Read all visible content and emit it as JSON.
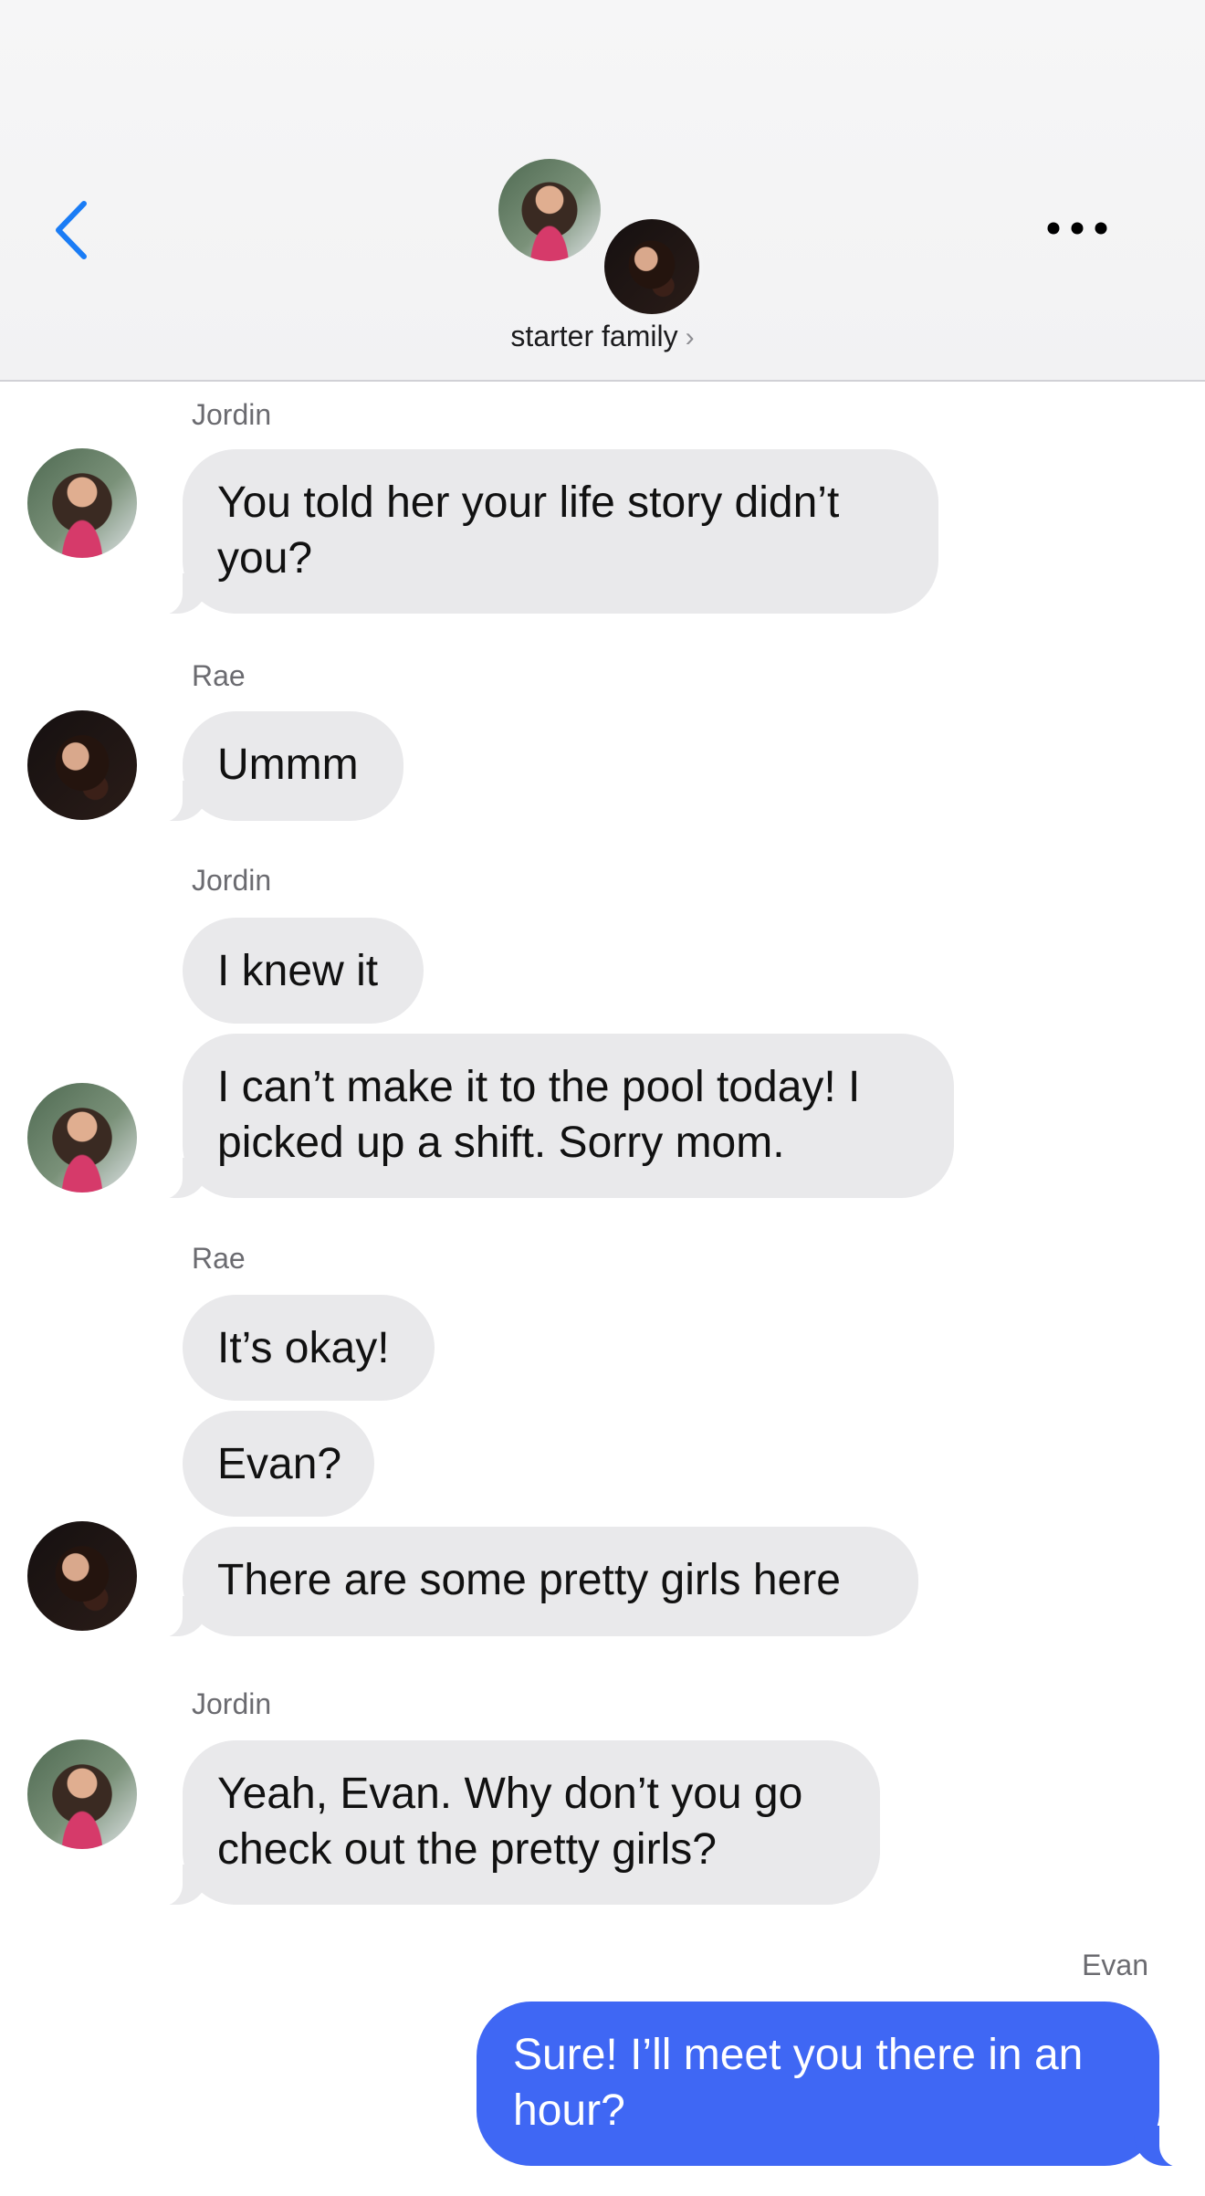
{
  "header": {
    "group_name": "starter family",
    "chevron": "›",
    "back_icon": "chevron-left-icon",
    "more_icon": "ellipsis-icon",
    "accent": "#1a7cf5"
  },
  "messages": [
    {
      "sender": "Jordin",
      "text": "You told her your life story didn’t you?"
    },
    {
      "sender": "Rae",
      "text": "Ummm"
    },
    {
      "sender": "Jordin",
      "text": "I knew it"
    },
    {
      "sender": "Jordin",
      "text": "I can’t make it to the pool today! I picked up a shift. Sorry mom."
    },
    {
      "sender": "Rae",
      "text": "It’s okay!"
    },
    {
      "sender": "Rae",
      "text": "Evan?"
    },
    {
      "sender": "Rae",
      "text": "There are some pretty girls here"
    },
    {
      "sender": "Jordin",
      "text": "Yeah, Evan. Why don’t you go check out the pretty girls?"
    },
    {
      "sender": "Evan",
      "text": "Sure! I’ll meet you there in an hour?"
    }
  ],
  "colors": {
    "incoming_bubble": "#e9e9eb",
    "outgoing_bubble": "#3f67f4",
    "header_bg": "#f4f4f5"
  }
}
